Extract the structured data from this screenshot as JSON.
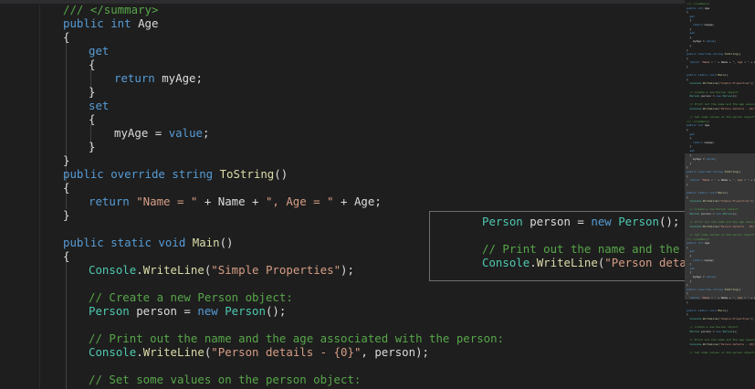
{
  "editor": {
    "lines": [
      {
        "segments": [
          {
            "t": "/// </summary>",
            "c": "cm"
          }
        ]
      },
      {
        "segments": [
          {
            "t": "public int ",
            "c": "kw"
          },
          {
            "t": "Age",
            "c": "pl"
          }
        ]
      },
      {
        "segments": [
          {
            "t": "{",
            "c": "pl"
          }
        ]
      },
      {
        "segments": [
          {
            "t": "get",
            "c": "kw"
          }
        ]
      },
      {
        "segments": [
          {
            "t": "{",
            "c": "pl"
          }
        ]
      },
      {
        "segments": [
          {
            "t": "return ",
            "c": "kw"
          },
          {
            "t": "myAge;",
            "c": "pl"
          }
        ]
      },
      {
        "segments": [
          {
            "t": "}",
            "c": "pl"
          }
        ]
      },
      {
        "segments": [
          {
            "t": "set",
            "c": "kw"
          }
        ]
      },
      {
        "segments": [
          {
            "t": "{",
            "c": "pl"
          }
        ]
      },
      {
        "segments": [
          {
            "t": "myAge = ",
            "c": "pl"
          },
          {
            "t": "value",
            "c": "kw"
          },
          {
            "t": ";",
            "c": "pl"
          }
        ]
      },
      {
        "segments": [
          {
            "t": "}",
            "c": "pl"
          }
        ]
      },
      {
        "segments": [
          {
            "t": "}",
            "c": "pl"
          }
        ]
      },
      {
        "segments": [
          {
            "t": "public override string ",
            "c": "kw"
          },
          {
            "t": "ToString",
            "c": "fn"
          },
          {
            "t": "()",
            "c": "pl"
          }
        ]
      },
      {
        "segments": [
          {
            "t": "{",
            "c": "pl"
          }
        ]
      },
      {
        "segments": [
          {
            "t": "return ",
            "c": "kw"
          },
          {
            "t": "\"Name = \"",
            "c": "str"
          },
          {
            "t": " + Name + ",
            "c": "pl"
          },
          {
            "t": "\", Age = \"",
            "c": "str"
          },
          {
            "t": " + Age;",
            "c": "pl"
          }
        ]
      },
      {
        "segments": [
          {
            "t": "}",
            "c": "pl"
          }
        ]
      },
      {
        "segments": [
          {
            "t": "",
            "c": "pl"
          }
        ]
      },
      {
        "segments": [
          {
            "t": "public static void ",
            "c": "kw"
          },
          {
            "t": "Main",
            "c": "fn"
          },
          {
            "t": "()",
            "c": "pl"
          }
        ]
      },
      {
        "segments": [
          {
            "t": "{",
            "c": "pl"
          }
        ]
      },
      {
        "segments": [
          {
            "t": "Console",
            "c": "ty"
          },
          {
            "t": ".",
            "c": "pl"
          },
          {
            "t": "WriteLine",
            "c": "fn"
          },
          {
            "t": "(",
            "c": "pl"
          },
          {
            "t": "\"Simple Properties\"",
            "c": "str"
          },
          {
            "t": ");",
            "c": "pl"
          }
        ]
      },
      {
        "segments": [
          {
            "t": "",
            "c": "pl"
          }
        ]
      },
      {
        "segments": [
          {
            "t": "// Create a new Person object:",
            "c": "cm"
          }
        ]
      },
      {
        "segments": [
          {
            "t": "Person ",
            "c": "ty"
          },
          {
            "t": "person = ",
            "c": "pl"
          },
          {
            "t": "new ",
            "c": "kw"
          },
          {
            "t": "Person",
            "c": "ty"
          },
          {
            "t": "();",
            "c": "pl"
          }
        ]
      },
      {
        "segments": [
          {
            "t": "",
            "c": "pl"
          }
        ]
      },
      {
        "segments": [
          {
            "t": "// Print out the name and the age associated with the person:",
            "c": "cm"
          }
        ]
      },
      {
        "segments": [
          {
            "t": "Console",
            "c": "ty"
          },
          {
            "t": ".",
            "c": "pl"
          },
          {
            "t": "WriteLine",
            "c": "fn"
          },
          {
            "t": "(",
            "c": "pl"
          },
          {
            "t": "\"Person details - {0}\"",
            "c": "str"
          },
          {
            "t": ", person);",
            "c": "pl"
          }
        ]
      },
      {
        "segments": [
          {
            "t": "",
            "c": "pl"
          }
        ]
      },
      {
        "segments": [
          {
            "t": "// Set some values on the person object:",
            "c": "cm"
          }
        ]
      }
    ]
  },
  "peek": {
    "lines": [
      {
        "segments": [
          {
            "t": "Person ",
            "c": "ty"
          },
          {
            "t": "person = ",
            "c": "pl"
          },
          {
            "t": "new ",
            "c": "kw"
          },
          {
            "t": "Person",
            "c": "ty"
          },
          {
            "t": "();",
            "c": "pl"
          }
        ]
      },
      {
        "segments": [
          {
            "t": "",
            "c": "pl"
          }
        ]
      },
      {
        "segments": [
          {
            "t": "// Print out the name and the ag",
            "c": "cm"
          }
        ]
      },
      {
        "segments": [
          {
            "t": "Console",
            "c": "ty"
          },
          {
            "t": ".",
            "c": "pl"
          },
          {
            "t": "WriteLine",
            "c": "fn"
          },
          {
            "t": "(",
            "c": "pl"
          },
          {
            "t": "\"Person detail",
            "c": "str"
          }
        ]
      }
    ]
  },
  "colors": {
    "background": "#1e1e1e",
    "keyword": "#569cd6",
    "type": "#4ec9b0",
    "method": "#dcdcaa",
    "string": "#d69d85",
    "comment": "#57a64a",
    "plain": "#dcdcdc"
  }
}
